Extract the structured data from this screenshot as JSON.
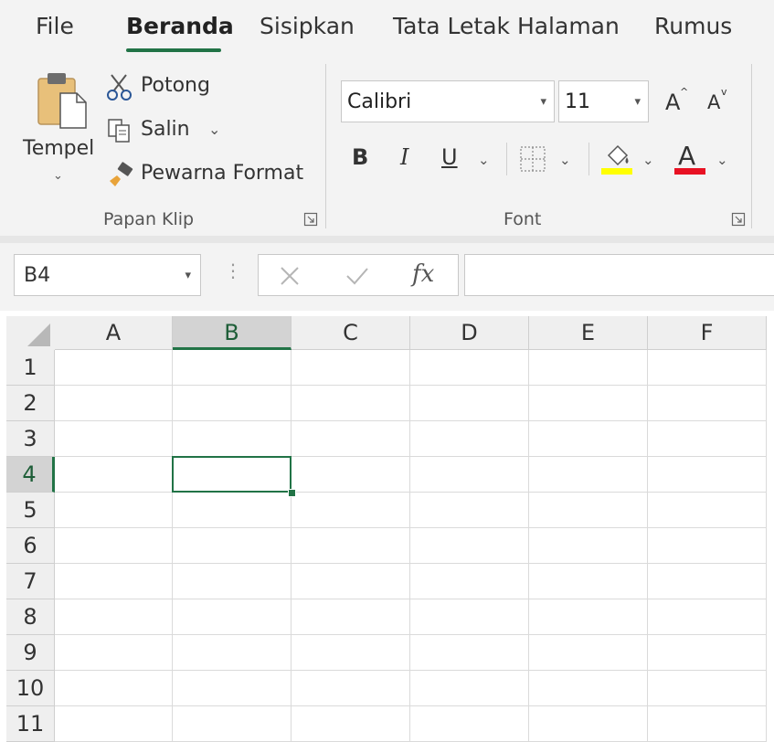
{
  "tabs": [
    {
      "label": "File",
      "active": false
    },
    {
      "label": "Beranda",
      "active": true
    },
    {
      "label": "Sisipkan",
      "active": false
    },
    {
      "label": "Tata Letak Halaman",
      "active": false
    },
    {
      "label": "Rumus",
      "active": false
    }
  ],
  "clipboard": {
    "paste_label": "Tempel",
    "cut_label": "Potong",
    "copy_label": "Salin",
    "format_painter_label": "Pewarna Format",
    "group_label": "Papan Klip"
  },
  "font": {
    "font_name": "Calibri",
    "font_size": "11",
    "bold": "B",
    "italic": "I",
    "underline": "U",
    "font_color_glyph": "A",
    "increase_size_glyph": "A",
    "decrease_size_glyph": "A",
    "group_label": "Font"
  },
  "formula_bar": {
    "name_box": "B4",
    "fx_label": "fx",
    "value": ""
  },
  "sheet": {
    "columns": [
      "A",
      "B",
      "C",
      "D",
      "E",
      "F"
    ],
    "rows": [
      "1",
      "2",
      "3",
      "4",
      "5",
      "6",
      "7",
      "8",
      "9",
      "10",
      "11"
    ],
    "selected_cell": "B4"
  },
  "colors": {
    "accent": "#217346",
    "fill_color": "#ffff00",
    "font_color": "#e81123"
  },
  "icons": [
    "paste-icon",
    "cut-icon",
    "copy-icon",
    "format-painter-icon",
    "borders-icon",
    "fill-color-icon",
    "dialog-launcher-icon"
  ]
}
